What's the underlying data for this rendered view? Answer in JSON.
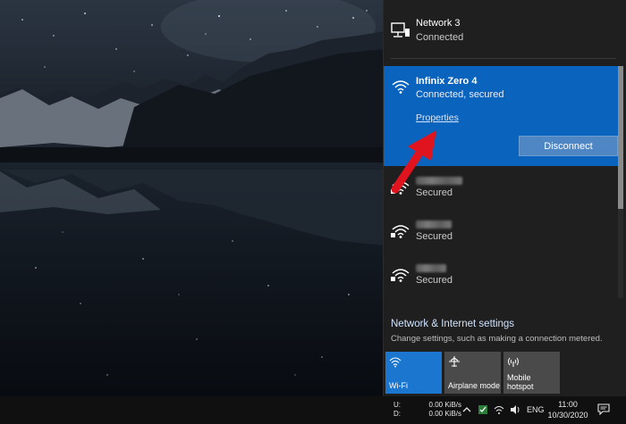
{
  "networks": {
    "network3": {
      "name": "Network 3",
      "status": "Connected",
      "icon": "ethernet-monitor-icon"
    },
    "active": {
      "name": "Infinix Zero 4",
      "status": "Connected, secured",
      "properties_label": "Properties",
      "disconnect_label": "Disconnect",
      "icon": "wifi-icon"
    },
    "others": [
      {
        "status": "Secured",
        "icon": "wifi-secured-icon"
      },
      {
        "status": "Secured",
        "icon": "wifi-secured-icon"
      },
      {
        "status": "Secured",
        "icon": "wifi-secured-icon"
      }
    ]
  },
  "settings": {
    "title": "Network & Internet settings",
    "description": "Change settings, such as making a connection metered."
  },
  "quick_actions": [
    {
      "label": "Wi-Fi",
      "icon": "wifi-icon",
      "active": true
    },
    {
      "label": "Airplane mode",
      "icon": "airplane-icon",
      "active": false
    },
    {
      "label": "Mobile hotspot",
      "label_line1": "Mobile",
      "label_line2": "hotspot",
      "icon": "hotspot-icon",
      "active": false
    }
  ],
  "taskbar": {
    "upload_label": "U:",
    "upload_value": "0.00 KiB/s",
    "download_label": "D:",
    "download_value": "0.00 KiB/s",
    "language": "ENG",
    "time": "11:00",
    "date": "10/30/2020"
  },
  "colors": {
    "accent": "#0a63bd",
    "wifi_tile": "#1b76d0",
    "arrow": "#e0141e",
    "flyout_bg": "#1f1f1f"
  }
}
